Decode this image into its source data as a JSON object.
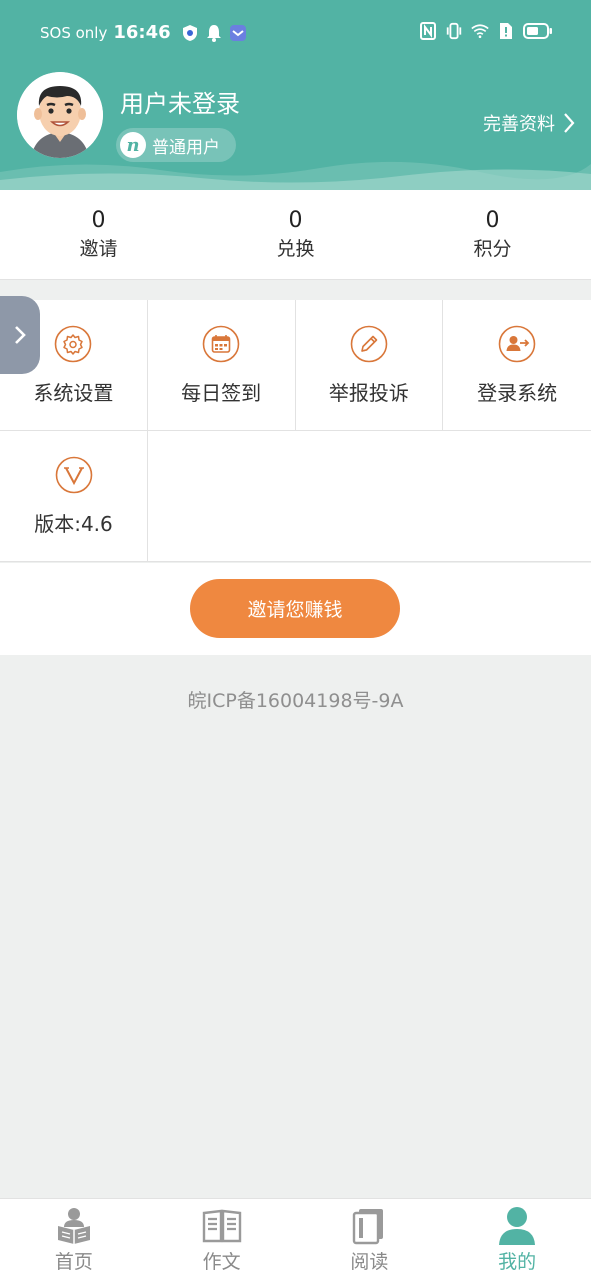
{
  "status_bar": {
    "carrier": "SOS only",
    "time": "16:46"
  },
  "profile": {
    "username": "用户未登录",
    "badge_icon_letter": "n",
    "badge_label": "普通用户",
    "complete_profile_label": "完善资料"
  },
  "stats": [
    {
      "value": "0",
      "label": "邀请"
    },
    {
      "value": "0",
      "label": "兑换"
    },
    {
      "value": "0",
      "label": "积分"
    }
  ],
  "menu": [
    {
      "label": "系统设置",
      "icon": "gear-icon"
    },
    {
      "label": "每日签到",
      "icon": "calendar-icon"
    },
    {
      "label": "举报投诉",
      "icon": "pencil-icon"
    },
    {
      "label": "登录系统",
      "icon": "user-login-icon"
    },
    {
      "label": "版本:4.6",
      "icon": "version-icon"
    }
  ],
  "invite_button": "邀请您赚钱",
  "icp": "皖ICP备16004198号-9A",
  "bottom_nav": [
    {
      "label": "首页",
      "icon": "reader-icon",
      "active": false
    },
    {
      "label": "作文",
      "icon": "book-icon",
      "active": false
    },
    {
      "label": "阅读",
      "icon": "notebook-icon",
      "active": false
    },
    {
      "label": "我的",
      "icon": "person-icon",
      "active": true
    }
  ],
  "colors": {
    "primary": "#52b3a4",
    "accent": "#ef8840",
    "icon_line": "#d9773a"
  }
}
